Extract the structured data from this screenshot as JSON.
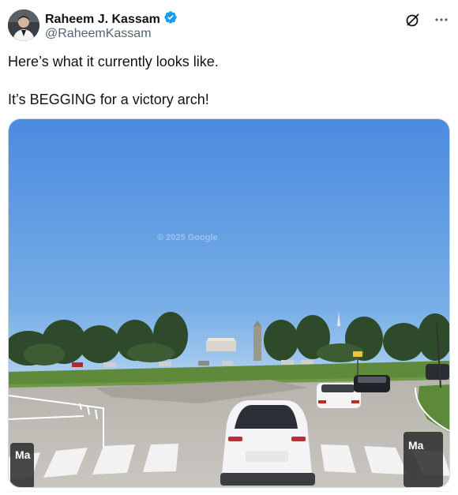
{
  "author": {
    "display_name": "Raheem J. Kassam",
    "handle": "@RaheemKassam",
    "verified": true,
    "verified_badge_color": "#1d9bf0",
    "avatar_icon": "avatar-photo"
  },
  "actions": {
    "grok_icon": "grok-icon",
    "more_icon": "more-icon",
    "more_label": "···"
  },
  "tweet": {
    "line1": "Here’s what it currently looks like.",
    "line2": "It’s BEGGING for a victory arch!"
  },
  "media": {
    "watermark": "© 2025 Google",
    "description_icon": "street-view-photo"
  },
  "colors": {
    "text": "#0f1419",
    "secondary": "#536471",
    "sky": "#4e8fdc",
    "grass": "#5a7d3a"
  }
}
